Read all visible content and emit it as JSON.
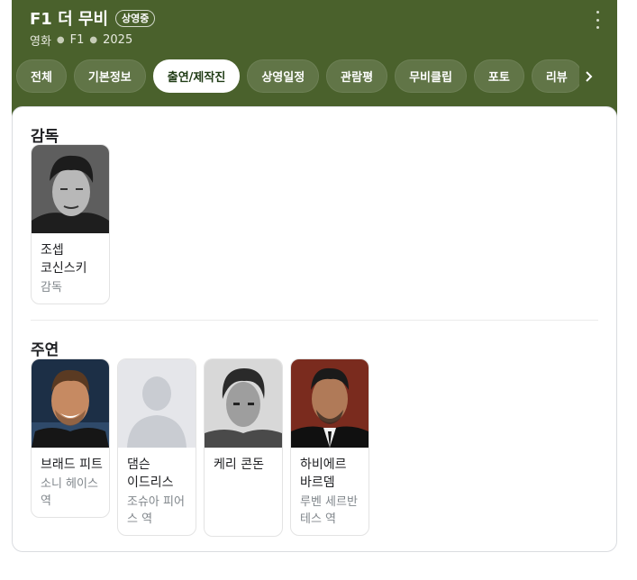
{
  "header": {
    "title": "F1 더 무비",
    "badge": "상영중",
    "subtitle": {
      "type": "영화",
      "title_short": "F1",
      "year": "2025"
    },
    "icons": {
      "more": "more-vert-icon",
      "next": "chevron-right-icon"
    },
    "colors": {
      "background": "#4a612c",
      "active_tab_text": "#1f3b14"
    }
  },
  "tabs": [
    {
      "label": "전체"
    },
    {
      "label": "기본정보"
    },
    {
      "label": "출연/제작진",
      "active": true
    },
    {
      "label": "상영일정"
    },
    {
      "label": "관람평"
    },
    {
      "label": "무비클립"
    },
    {
      "label": "포토"
    },
    {
      "label": "리뷰"
    }
  ],
  "directors": {
    "title": "감독",
    "people": [
      {
        "name": "조셉 코신스키",
        "role": "감독",
        "photo": "photo-grayscale"
      }
    ]
  },
  "cast": {
    "title": "주연",
    "people": [
      {
        "name": "브래드 피트",
        "role": "소니 헤이스 역",
        "photo": "photo-color"
      },
      {
        "name": "댐슨 이드리스",
        "role": "조슈아 피어스 역",
        "photo": "placeholder-avatar-icon"
      },
      {
        "name": "케리 콘돈",
        "role": "",
        "photo": "photo-grayscale"
      },
      {
        "name": "하비에르 바르뎀",
        "role": "루벤 세르반테스 역",
        "photo": "photo-color"
      }
    ]
  }
}
